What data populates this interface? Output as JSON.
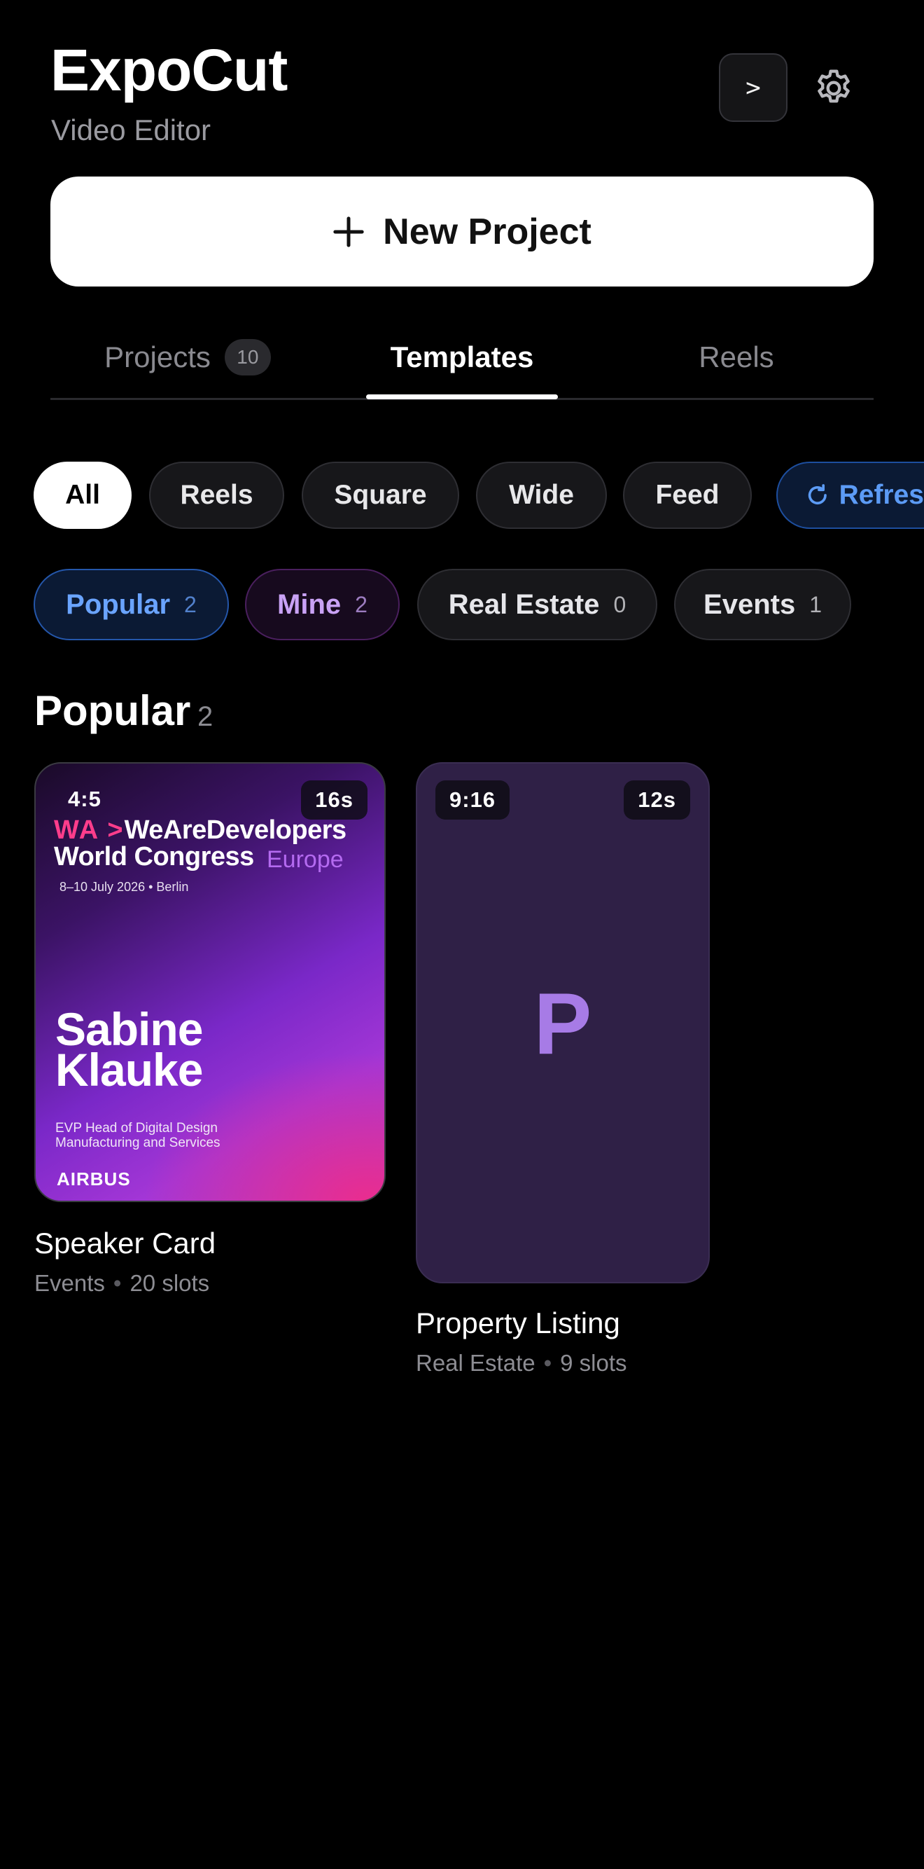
{
  "header": {
    "title": "ExpoCut",
    "subtitle": "Video Editor",
    "terminal_label": ">",
    "settings_icon": "gear-icon"
  },
  "new_project": {
    "label": "New Project",
    "icon": "plus-icon"
  },
  "tabs": [
    {
      "label": "Projects",
      "count": "10",
      "active": false
    },
    {
      "label": "Templates",
      "active": true
    },
    {
      "label": "Reels",
      "active": false
    }
  ],
  "format_filters": [
    {
      "label": "All",
      "active": true
    },
    {
      "label": "Reels"
    },
    {
      "label": "Square"
    },
    {
      "label": "Wide"
    },
    {
      "label": "Feed"
    },
    {
      "label": "Refres",
      "icon": "refresh-icon"
    }
  ],
  "category_filters": [
    {
      "label": "Popular",
      "count": "2",
      "color": "#6aa4ff"
    },
    {
      "label": "Mine",
      "count": "2",
      "color": "#c9a2f5"
    },
    {
      "label": "Real Estate",
      "count": "0"
    },
    {
      "label": "Events",
      "count": "1"
    }
  ],
  "section": {
    "title": "Popular",
    "count": "2"
  },
  "templates": [
    {
      "title": "Speaker Card",
      "category": "Events",
      "slots": "20 slots",
      "aspect": "4:5",
      "duration": "16s",
      "poster": {
        "wa": "WA >",
        "brand": "WeAreDevelopers",
        "line2": "World Congress",
        "region": "Europe",
        "date": "8–10 July 2026 • Berlin",
        "name_line1": "Sabine",
        "name_line2": "Klauke",
        "role_line1": "EVP Head of Digital Design",
        "role_line2": "Manufacturing and Services",
        "company": "AIRBUS"
      }
    },
    {
      "title": "Property Listing",
      "category": "Real Estate",
      "slots": "9 slots",
      "aspect": "9:16",
      "duration": "12s",
      "placeholder_letter": "P"
    }
  ],
  "colors": {
    "background": "#000000",
    "accent_blue": "#5c9bf5",
    "accent_purple": "#a77be6",
    "accent_pink": "#ff3d8b"
  }
}
